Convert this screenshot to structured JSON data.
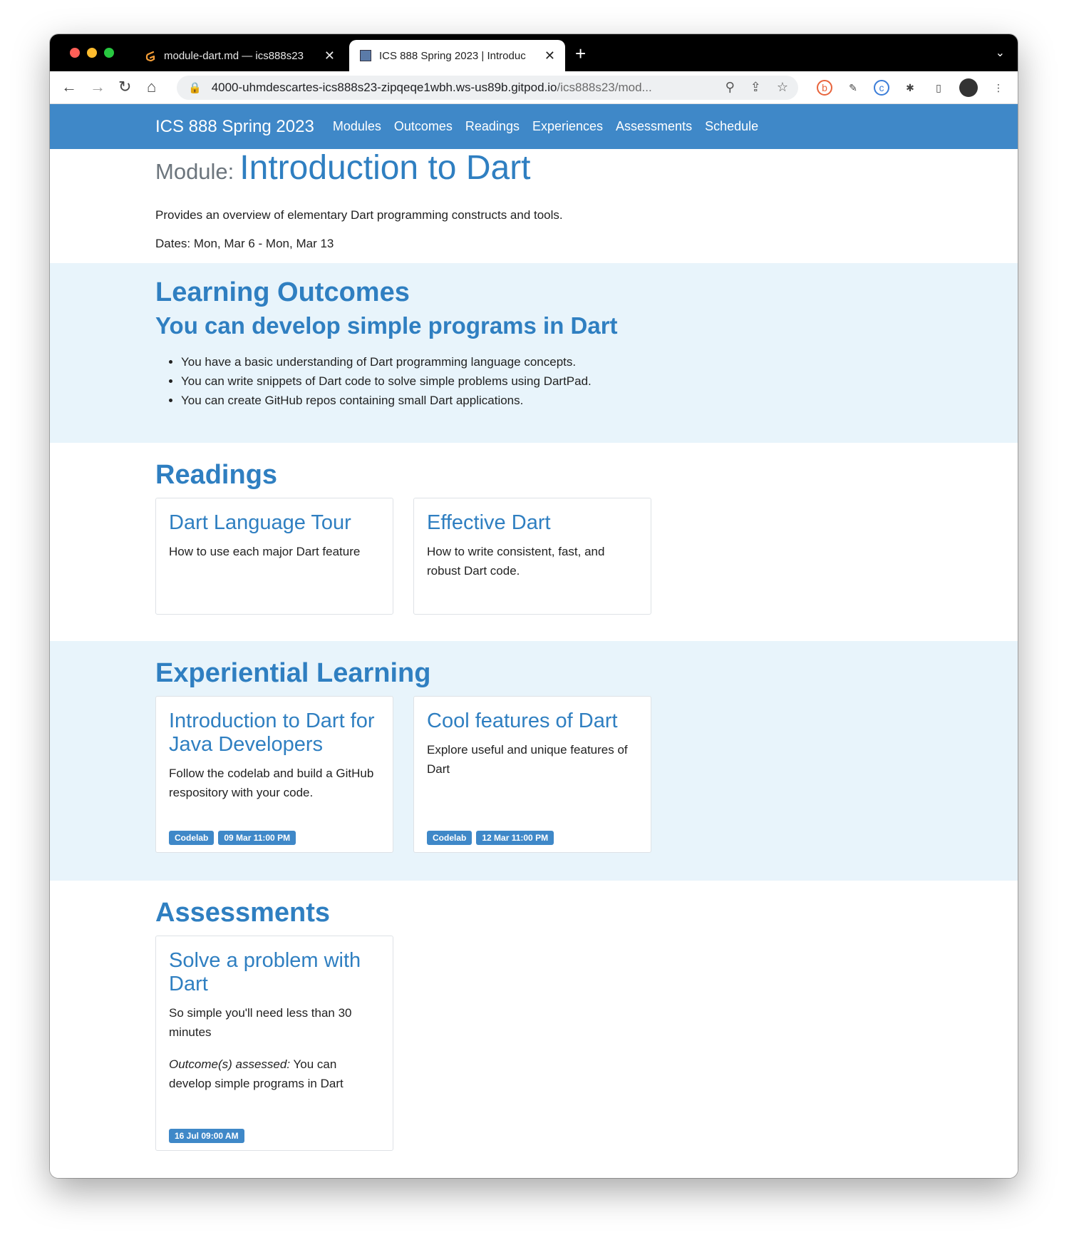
{
  "browser": {
    "tabs": [
      {
        "title": "module-dart.md — ics888s23",
        "active": false
      },
      {
        "title": "ICS 888 Spring 2023 | Introduc",
        "active": true
      }
    ],
    "url_host": "4000-uhmdescartes-ics888s23-zipqeqe1wbh.ws-us89b.gitpod.io",
    "url_path": "/ics888s23/mod..."
  },
  "navbar": {
    "brand": "ICS 888 Spring 2023",
    "links": [
      "Modules",
      "Outcomes",
      "Readings",
      "Experiences",
      "Assessments",
      "Schedule"
    ]
  },
  "module": {
    "label": "Module:",
    "title": "Introduction to Dart",
    "description": "Provides an overview of elementary Dart programming constructs and tools.",
    "dates": "Dates: Mon, Mar 6 - Mon, Mar 13"
  },
  "outcomes": {
    "heading": "Learning Outcomes",
    "title": "You can develop simple programs in Dart",
    "items": [
      "You have a basic understanding of Dart programming language concepts.",
      "You can write snippets of Dart code to solve simple problems using DartPad.",
      "You can create GitHub repos containing small Dart applications."
    ]
  },
  "readings": {
    "heading": "Readings",
    "cards": [
      {
        "title": "Dart Language Tour",
        "text": "How to use each major Dart feature"
      },
      {
        "title": "Effective Dart",
        "text": "How to write consistent, fast, and robust Dart code."
      }
    ]
  },
  "experiences": {
    "heading": "Experiential Learning",
    "cards": [
      {
        "title": "Introduction to Dart for Java Developers",
        "text": "Follow the codelab and build a GitHub respository with your code.",
        "badges": [
          "Codelab",
          "09 Mar 11:00 PM"
        ]
      },
      {
        "title": "Cool features of Dart",
        "text": "Explore useful and unique features of Dart",
        "badges": [
          "Codelab",
          "12 Mar 11:00 PM"
        ]
      }
    ]
  },
  "assessments": {
    "heading": "Assessments",
    "cards": [
      {
        "title": "Solve a problem with Dart",
        "text": "So simple you'll need less than 30 minutes",
        "outcome_label": "Outcome(s) assessed:",
        "outcome_text": " You can develop simple programs in Dart",
        "badges": [
          "16 Jul 09:00 AM"
        ]
      }
    ]
  }
}
